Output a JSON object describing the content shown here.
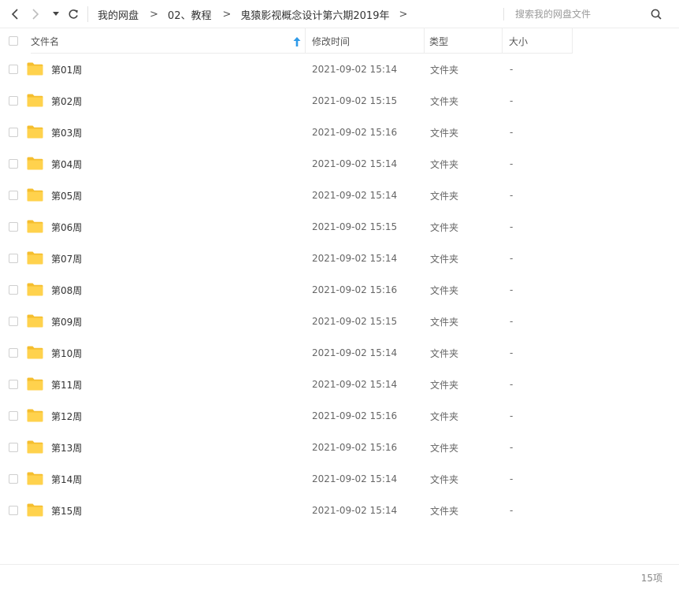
{
  "toolbar": {
    "back_icon": "chevron-left-icon",
    "forward_icon": "chevron-right-icon",
    "history_icon": "caret-down-icon",
    "refresh_icon": "refresh-icon"
  },
  "breadcrumb": {
    "items": [
      "我的网盘",
      "02、教程",
      "鬼猿影视概念设计第六期2019年"
    ],
    "separator": ">"
  },
  "search": {
    "placeholder": "搜索我的网盘文件",
    "value": "",
    "icon": "search-icon"
  },
  "columns": {
    "name": "文件名",
    "modified": "修改时间",
    "type": "类型",
    "size": "大小",
    "sort_icon": "sort-ascending-arrow-icon"
  },
  "colors": {
    "folder": "#FFD24D",
    "folder_tab": "#F5BE2E",
    "sort_arrow": "#2F9AE8",
    "text": "#333333",
    "muted": "#666666"
  },
  "files": [
    {
      "name": "第01周",
      "modified": "2021-09-02 15:14",
      "type": "文件夹",
      "size": "-"
    },
    {
      "name": "第02周",
      "modified": "2021-09-02 15:15",
      "type": "文件夹",
      "size": "-"
    },
    {
      "name": "第03周",
      "modified": "2021-09-02 15:16",
      "type": "文件夹",
      "size": "-"
    },
    {
      "name": "第04周",
      "modified": "2021-09-02 15:14",
      "type": "文件夹",
      "size": "-"
    },
    {
      "name": "第05周",
      "modified": "2021-09-02 15:14",
      "type": "文件夹",
      "size": "-"
    },
    {
      "name": "第06周",
      "modified": "2021-09-02 15:15",
      "type": "文件夹",
      "size": "-"
    },
    {
      "name": "第07周",
      "modified": "2021-09-02 15:14",
      "type": "文件夹",
      "size": "-"
    },
    {
      "name": "第08周",
      "modified": "2021-09-02 15:16",
      "type": "文件夹",
      "size": "-"
    },
    {
      "name": "第09周",
      "modified": "2021-09-02 15:15",
      "type": "文件夹",
      "size": "-"
    },
    {
      "name": "第10周",
      "modified": "2021-09-02 15:14",
      "type": "文件夹",
      "size": "-"
    },
    {
      "name": "第11周",
      "modified": "2021-09-02 15:14",
      "type": "文件夹",
      "size": "-"
    },
    {
      "name": "第12周",
      "modified": "2021-09-02 15:16",
      "type": "文件夹",
      "size": "-"
    },
    {
      "name": "第13周",
      "modified": "2021-09-02 15:16",
      "type": "文件夹",
      "size": "-"
    },
    {
      "name": "第14周",
      "modified": "2021-09-02 15:14",
      "type": "文件夹",
      "size": "-"
    },
    {
      "name": "第15周",
      "modified": "2021-09-02 15:14",
      "type": "文件夹",
      "size": "-"
    }
  ],
  "footer": {
    "count": "15项"
  }
}
